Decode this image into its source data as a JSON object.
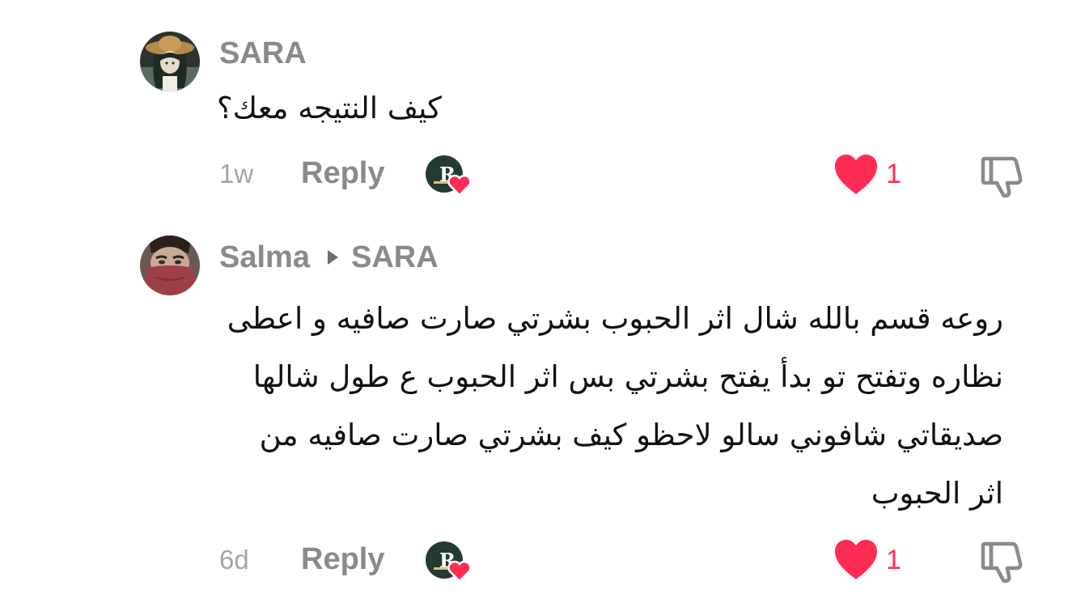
{
  "comments": [
    {
      "username": "SARA",
      "text": "كيف النتيجه معك؟",
      "time": "1w",
      "reply_label": "Reply",
      "likes": "1",
      "avatar_icon": "avatar-girl-straw-hat",
      "creator_like_badge": "R"
    },
    {
      "username": "Salma",
      "reply_to": "SARA",
      "text_lines": [
        "روعه قسم بالله شال اثر الحبوب بشرتي صارت صافيه و اعطى",
        "نظاره وتفتح تو بدأ يفتح بشرتي بس اثر الحبوب ع طول شالها",
        "صديقاتي شافوني سالو لاحظو كيف بشرتي صارت صافيه من",
        "اثر الحبوب"
      ],
      "time": "6d",
      "reply_label": "Reply",
      "likes": "1",
      "avatar_icon": "avatar-face-covered",
      "creator_like_badge": "R"
    }
  ],
  "colors": {
    "accent_like": "#fe2c55",
    "username_gray": "#8a8a8a",
    "time_gray": "#a4a4a4",
    "text": "#111111"
  },
  "icons": {
    "like": "heart-icon",
    "dislike": "thumbs-down-icon",
    "reply_arrow": "caret-right-icon",
    "creator_badge": "creator-liked-icon"
  }
}
